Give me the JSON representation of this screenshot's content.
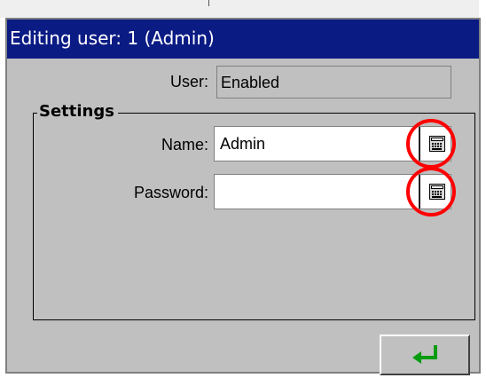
{
  "window": {
    "title": "Editing user: 1 (Admin)"
  },
  "user_status": {
    "label": "User:",
    "value": "Enabled"
  },
  "settings": {
    "title": "Settings",
    "name_label": "Name:",
    "name_value": "Admin",
    "password_label": "Password:",
    "password_value": ""
  },
  "icons": {
    "keyboard": "keyboard-icon",
    "confirm": "enter-arrow-icon"
  },
  "colors": {
    "title_bar": "#0b1b84",
    "highlight": "#ff0000",
    "window_background": "#c0c0c0",
    "confirm_arrow": "#079c0f"
  }
}
